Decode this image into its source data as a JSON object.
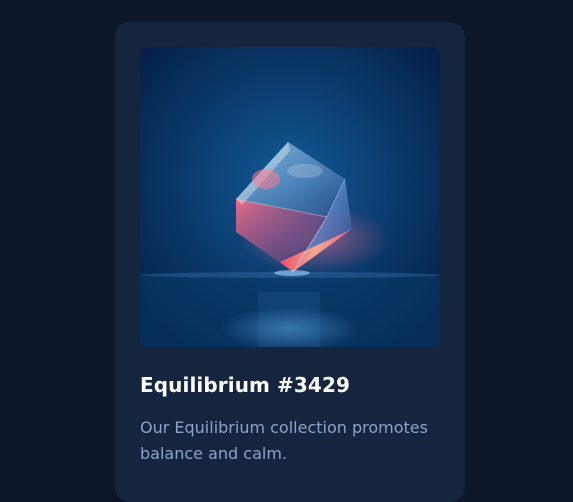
{
  "card": {
    "title": "Equilibrium #3429",
    "description": "Our Equilibrium collection promotes balance and calm."
  },
  "image": {
    "subject": "glowing-glass-cube"
  },
  "colors": {
    "page_background": "#0e1729",
    "card_background": "#15253e",
    "title": "#ffffff",
    "description": "#8ba3cc"
  }
}
